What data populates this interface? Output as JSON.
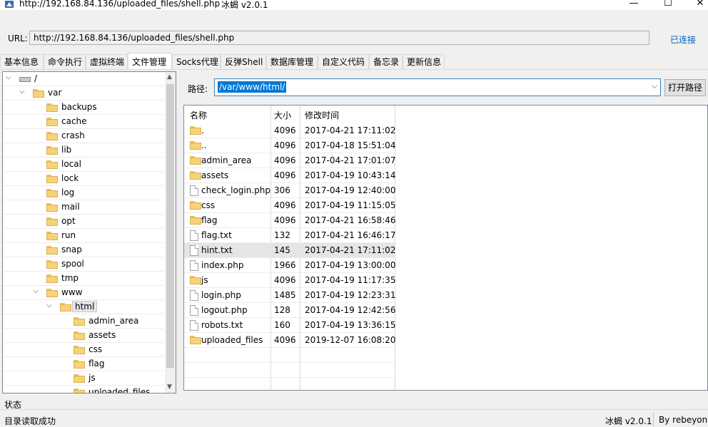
{
  "window": {
    "title": "http://192.168.84.136/uploaded_files/shell.php",
    "app_name": "冰蝎 v2.0.1",
    "minimize": "—",
    "maximize": "☐",
    "close": "✕"
  },
  "url_bar": {
    "label": "URL:",
    "value": "http://192.168.84.136/uploaded_files/shell.php",
    "status": "已连接"
  },
  "tabs": [
    "基本信息",
    "命令执行",
    "虚拟终端",
    "文件管理",
    "Socks代理",
    "反弹Shell",
    "数据库管理",
    "自定义代码",
    "备忘录",
    "更新信息"
  ],
  "active_tab": "文件管理",
  "tree": [
    {
      "label": "/",
      "depth": 0,
      "expanded": true,
      "type": "drive"
    },
    {
      "label": "var",
      "depth": 1,
      "expanded": true,
      "type": "folder"
    },
    {
      "label": "backups",
      "depth": 2,
      "type": "folder"
    },
    {
      "label": "cache",
      "depth": 2,
      "type": "folder"
    },
    {
      "label": "crash",
      "depth": 2,
      "type": "folder"
    },
    {
      "label": "lib",
      "depth": 2,
      "type": "folder"
    },
    {
      "label": "local",
      "depth": 2,
      "type": "folder"
    },
    {
      "label": "lock",
      "depth": 2,
      "type": "folder"
    },
    {
      "label": "log",
      "depth": 2,
      "type": "folder"
    },
    {
      "label": "mail",
      "depth": 2,
      "type": "folder"
    },
    {
      "label": "opt",
      "depth": 2,
      "type": "folder"
    },
    {
      "label": "run",
      "depth": 2,
      "type": "folder"
    },
    {
      "label": "snap",
      "depth": 2,
      "type": "folder"
    },
    {
      "label": "spool",
      "depth": 2,
      "type": "folder"
    },
    {
      "label": "tmp",
      "depth": 2,
      "type": "folder"
    },
    {
      "label": "www",
      "depth": 2,
      "expanded": true,
      "type": "folder"
    },
    {
      "label": "html",
      "depth": 3,
      "expanded": true,
      "selected": true,
      "type": "folder"
    },
    {
      "label": "admin_area",
      "depth": 4,
      "type": "folder"
    },
    {
      "label": "assets",
      "depth": 4,
      "type": "folder"
    },
    {
      "label": "css",
      "depth": 4,
      "type": "folder"
    },
    {
      "label": "flag",
      "depth": 4,
      "type": "folder"
    },
    {
      "label": "js",
      "depth": 4,
      "type": "folder"
    },
    {
      "label": "uploaded_files",
      "depth": 4,
      "type": "folder"
    }
  ],
  "path": {
    "label": "路径:",
    "value": "/var/www/html/",
    "open_button": "打开路径"
  },
  "files": {
    "headers": [
      "名称",
      "大小",
      "修改时间"
    ],
    "rows": [
      {
        "name": ".",
        "size": "4096",
        "mtime": "2017-04-21 17:11:02",
        "type": "folder"
      },
      {
        "name": "..",
        "size": "4096",
        "mtime": "2017-04-18 15:51:04",
        "type": "folder"
      },
      {
        "name": "admin_area",
        "size": "4096",
        "mtime": "2017-04-21 17:01:07",
        "type": "folder"
      },
      {
        "name": "assets",
        "size": "4096",
        "mtime": "2017-04-19 10:43:14",
        "type": "folder"
      },
      {
        "name": "check_login.php",
        "size": "306",
        "mtime": "2017-04-19 12:40:00",
        "type": "file"
      },
      {
        "name": "css",
        "size": "4096",
        "mtime": "2017-04-19 11:15:05",
        "type": "folder"
      },
      {
        "name": "flag",
        "size": "4096",
        "mtime": "2017-04-21 16:58:46",
        "type": "folder"
      },
      {
        "name": "flag.txt",
        "size": "132",
        "mtime": "2017-04-21 16:46:17",
        "type": "file"
      },
      {
        "name": "hint.txt",
        "size": "145",
        "mtime": "2017-04-21 17:11:02",
        "type": "file",
        "selected": true
      },
      {
        "name": "index.php",
        "size": "1966",
        "mtime": "2017-04-19 13:00:00",
        "type": "file"
      },
      {
        "name": "js",
        "size": "4096",
        "mtime": "2017-04-19 11:17:35",
        "type": "folder"
      },
      {
        "name": "login.php",
        "size": "1485",
        "mtime": "2017-04-19 12:23:31",
        "type": "file"
      },
      {
        "name": "logout.php",
        "size": "128",
        "mtime": "2017-04-19 12:42:56",
        "type": "file"
      },
      {
        "name": "robots.txt",
        "size": "160",
        "mtime": "2017-04-19 13:36:15",
        "type": "file"
      },
      {
        "name": "uploaded_files",
        "size": "4096",
        "mtime": "2019-12-07 16:08:20",
        "type": "folder"
      }
    ]
  },
  "status_bar": {
    "label": "状态",
    "message": "目录读取成功",
    "version": "冰蝎 v2.0.1",
    "author": "By rebeyond"
  },
  "colors": {
    "accent_link": "#0060c0",
    "selection": "#0078d7",
    "folder": "#f7d27a"
  }
}
